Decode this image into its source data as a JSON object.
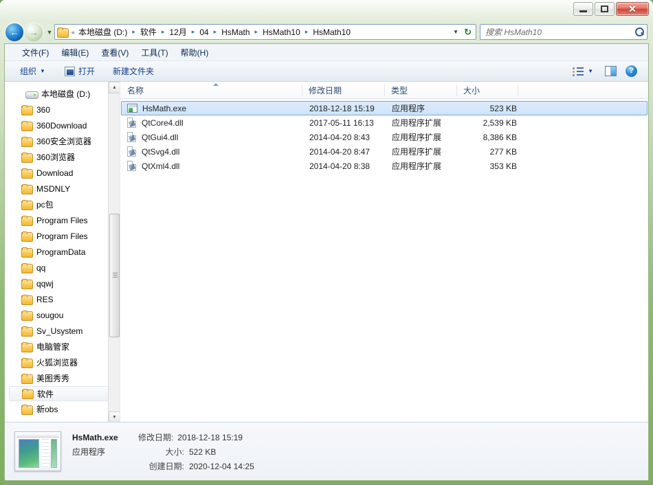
{
  "window": {
    "controls": {
      "minimize": "–",
      "maximize": "□",
      "close": "✕"
    }
  },
  "nav": {
    "back_label": "◀",
    "forward_label": "▶",
    "history_dropdown": "▼",
    "folder_icon": "folder-icon",
    "overflow": "«",
    "breadcrumbs": [
      "本地磁盘 (D:)",
      "软件",
      "12月",
      "04",
      "HsMath",
      "HsMath10",
      "HsMath10"
    ],
    "separator": "▸",
    "address_dropdown": "▼",
    "refresh_label": "↻"
  },
  "search": {
    "placeholder": "搜索 HsMath10",
    "value": "",
    "icon": "search-icon"
  },
  "menubar": {
    "items": [
      {
        "text": "文件(F)",
        "pre": "文件(",
        "key": "F",
        "post": ")"
      },
      {
        "text": "编辑(E)",
        "pre": "编辑(",
        "key": "E",
        "post": ")"
      },
      {
        "text": "查看(V)",
        "pre": "查看(",
        "key": "V",
        "post": ")"
      },
      {
        "text": "工具(T)",
        "pre": "工具(",
        "key": "T",
        "post": ")"
      },
      {
        "text": "帮助(H)",
        "pre": "帮助(",
        "key": "H",
        "post": ")"
      }
    ]
  },
  "toolbar": {
    "organize_label": "组织",
    "organize_caret": "▼",
    "open_label": "打开",
    "new_folder_label": "新建文件夹",
    "view_caret": "▼",
    "icons": {
      "view": "list-view-icon",
      "preview_pane": "preview-pane-icon",
      "help": "help-icon"
    },
    "help_glyph": "?"
  },
  "sidebar": {
    "root": {
      "label": "本地磁盘 (D:)",
      "icon": "hard-drive-icon"
    },
    "items": [
      {
        "label": "360",
        "selected": false
      },
      {
        "label": "360Download",
        "selected": false
      },
      {
        "label": "360安全浏览器",
        "selected": false
      },
      {
        "label": "360浏览器",
        "selected": false
      },
      {
        "label": "Download",
        "selected": false
      },
      {
        "label": "MSDNLY",
        "selected": false
      },
      {
        "label": "pc包",
        "selected": false
      },
      {
        "label": "Program Files",
        "selected": false
      },
      {
        "label": "Program Files",
        "selected": false
      },
      {
        "label": "ProgramData",
        "selected": false
      },
      {
        "label": "qq",
        "selected": false
      },
      {
        "label": "qqwj",
        "selected": false
      },
      {
        "label": "RES",
        "selected": false
      },
      {
        "label": "sougou",
        "selected": false
      },
      {
        "label": "Sv_Usystem",
        "selected": false
      },
      {
        "label": "电脑管家",
        "selected": false
      },
      {
        "label": "火狐浏览器",
        "selected": false
      },
      {
        "label": "美图秀秀",
        "selected": false
      },
      {
        "label": "软件",
        "selected": true
      },
      {
        "label": "新obs",
        "selected": false
      }
    ],
    "scroll_up": "▲",
    "scroll_down": "▼"
  },
  "filelist": {
    "columns": [
      {
        "label": "名称"
      },
      {
        "label": "修改日期"
      },
      {
        "label": "类型"
      },
      {
        "label": "大小"
      }
    ],
    "sort_column": "名称",
    "sort_direction": "ascending",
    "rows": [
      {
        "name": "HsMath.exe",
        "date": "2018-12-18 15:19",
        "type": "应用程序",
        "size": "523 KB",
        "icon": "exe-icon",
        "selected": true
      },
      {
        "name": "QtCore4.dll",
        "date": "2017-05-11 16:13",
        "type": "应用程序扩展",
        "size": "2,539 KB",
        "icon": "dll-icon",
        "selected": false
      },
      {
        "name": "QtGui4.dll",
        "date": "2014-04-20 8:43",
        "type": "应用程序扩展",
        "size": "8,386 KB",
        "icon": "dll-icon",
        "selected": false
      },
      {
        "name": "QtSvg4.dll",
        "date": "2014-04-20 8:47",
        "type": "应用程序扩展",
        "size": "277 KB",
        "icon": "dll-icon",
        "selected": false
      },
      {
        "name": "QtXml4.dll",
        "date": "2014-04-20 8:38",
        "type": "应用程序扩展",
        "size": "353 KB",
        "icon": "dll-icon",
        "selected": false
      }
    ]
  },
  "details": {
    "filename": "HsMath.exe",
    "filetype": "应用程序",
    "modified_label": "修改日期:",
    "modified_value": "2018-12-18 15:19",
    "size_label": "大小:",
    "size_value": "522 KB",
    "created_label": "创建日期:",
    "created_value": "2020-12-04 14:25",
    "thumbnail": "file-preview-thumbnail"
  },
  "colors": {
    "frame": "#8fbb72",
    "selection": "#cfe4f9",
    "selection_border": "#7aa9d8",
    "header_text": "#2b4a6f",
    "close_button": "#cd4436"
  }
}
